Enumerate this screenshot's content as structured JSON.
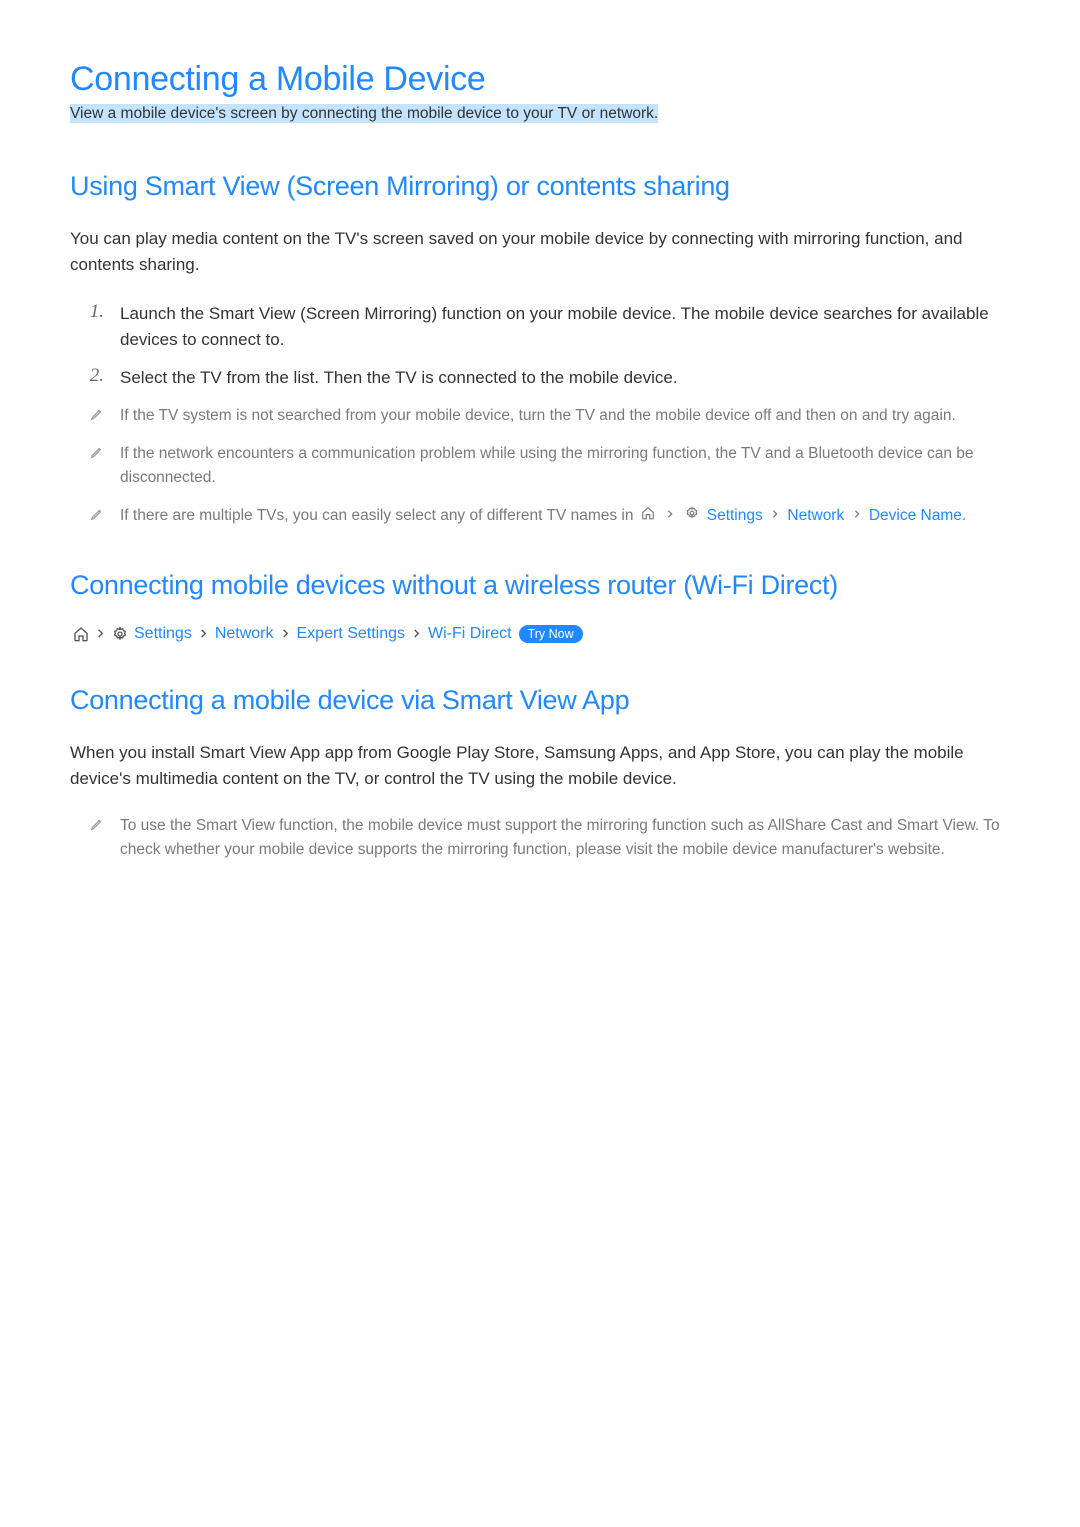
{
  "title": "Connecting a Mobile Device",
  "subtitle": "View a mobile device's screen by connecting the mobile device to your TV or network.",
  "sections": {
    "smart_view": {
      "heading": "Using Smart View (Screen Mirroring) or contents sharing",
      "intro": "You can play media content on the TV's screen saved on your mobile device by connecting with mirroring function, and contents sharing.",
      "steps": [
        "Launch the Smart View (Screen Mirroring) function on your mobile device. The mobile device searches for available devices to connect to.",
        "Select the TV from the list. Then the TV is connected to the mobile device."
      ],
      "notes": {
        "n1": "If the TV system is not searched from your mobile device, turn the TV and the mobile device off and then on and try again.",
        "n2": "If the network encounters a communication problem while using the mirroring function, the TV and a Bluetooth device can be disconnected.",
        "n3_prefix": "If there are multiple TVs, you can easily select any of different TV names in ",
        "n3_path": {
          "settings": "Settings",
          "network": "Network",
          "device_name": "Device Name"
        }
      }
    },
    "wifi_direct": {
      "heading": "Connecting mobile devices without a wireless router (Wi-Fi Direct)",
      "breadcrumb": {
        "settings": "Settings",
        "network": "Network",
        "expert": "Expert Settings",
        "wifi_direct": "Wi-Fi Direct",
        "try_now": "Try Now"
      }
    },
    "smart_view_app": {
      "heading": "Connecting a mobile device via Smart View App",
      "intro": "When you install Smart View App app from Google Play Store, Samsung Apps, and App Store, you can play the mobile device's multimedia content on the TV, or control the TV using the mobile device.",
      "note": "To use the Smart View function, the mobile device must support the mirroring function such as AllShare Cast and Smart View. To check whether your mobile device supports the mirroring function, please visit the mobile device manufacturer's website."
    }
  }
}
